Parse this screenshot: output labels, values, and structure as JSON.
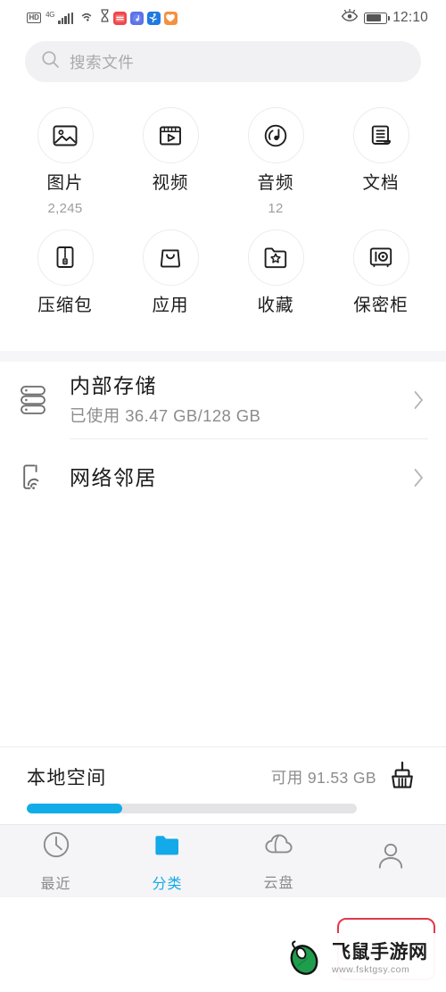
{
  "statusbar": {
    "hd_label": "HD",
    "network_label": "4G",
    "icons": [
      "hd-badge",
      "signal-bars",
      "wifi-icon",
      "hourglass-icon",
      "app-red-icon",
      "app-music-icon",
      "app-sports-icon",
      "app-weather-icon"
    ],
    "right_icons": [
      "eye-care-icon",
      "battery-icon"
    ],
    "time": "12:10"
  },
  "search": {
    "placeholder": "搜索文件",
    "icon": "search-icon"
  },
  "categories": [
    {
      "label": "图片",
      "count": "2,245",
      "icon": "image-icon"
    },
    {
      "label": "视频",
      "count": "",
      "icon": "video-icon"
    },
    {
      "label": "音频",
      "count": "12",
      "icon": "audio-disc-icon"
    },
    {
      "label": "文档",
      "count": "",
      "icon": "document-scroll-icon"
    },
    {
      "label": "压缩包",
      "count": "",
      "icon": "zip-archive-icon"
    },
    {
      "label": "应用",
      "count": "",
      "icon": "app-bag-icon"
    },
    {
      "label": "收藏",
      "count": "",
      "icon": "favorite-folder-icon"
    },
    {
      "label": "保密柜",
      "count": "",
      "icon": "safe-vault-icon"
    }
  ],
  "storage_rows": [
    {
      "title": "内部存储",
      "subtitle": "已使用 36.47 GB/128 GB",
      "icon": "internal-storage-icon",
      "chevron": "chevron-right-icon"
    },
    {
      "title": "网络邻居",
      "subtitle": "",
      "icon": "network-neighbor-icon",
      "chevron": "chevron-right-icon"
    }
  ],
  "local_space": {
    "title": "本地空间",
    "available": "可用 91.53 GB",
    "progress_percent": 29,
    "broom_icon": "broom-clean-icon",
    "fill_color": "#11ace8",
    "track_color": "#e4e4e6"
  },
  "tabbar": {
    "active_color": "#14a9e8",
    "inactive_color": "#8b8b90",
    "tabs": [
      {
        "label": "最近",
        "icon": "clock-icon",
        "active": false
      },
      {
        "label": "分类",
        "icon": "folder-icon",
        "active": true
      },
      {
        "label": "云盘",
        "icon": "cloud-icon",
        "active": false
      },
      {
        "label": "",
        "icon": "person-icon",
        "active": false
      }
    ]
  },
  "highlight": {
    "color": "#e0394a",
    "target": "profile-tab"
  },
  "watermark": {
    "title": "飞鼠手游网",
    "url": "www.fsktgsy.com",
    "icon": "mouse-logo-icon"
  }
}
